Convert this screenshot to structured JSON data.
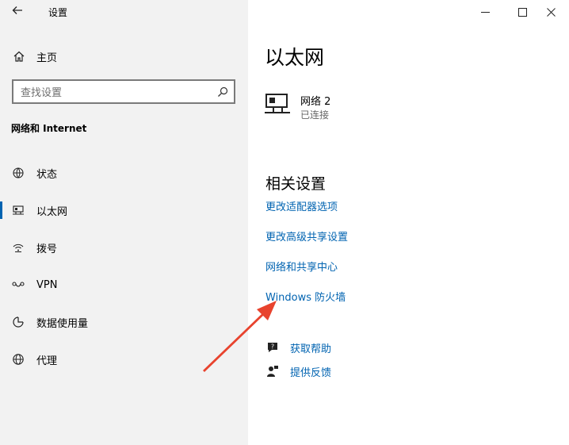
{
  "window": {
    "title": "设置",
    "back_icon": "back-arrow-icon",
    "controls": [
      "minimize-icon",
      "maximize-icon",
      "close-icon"
    ]
  },
  "sidebar": {
    "home_label": "主页",
    "search_placeholder": "查找设置",
    "section_title": "网络和 Internet",
    "items": [
      {
        "label": "状态",
        "icon": "globe-status-icon",
        "active": false
      },
      {
        "label": "以太网",
        "icon": "ethernet-icon",
        "active": true
      },
      {
        "label": "拨号",
        "icon": "dialup-icon",
        "active": false
      },
      {
        "label": "VPN",
        "icon": "vpn-icon",
        "active": false
      },
      {
        "label": "数据使用量",
        "icon": "data-usage-icon",
        "active": false
      },
      {
        "label": "代理",
        "icon": "globe-icon",
        "active": false
      }
    ]
  },
  "main": {
    "title": "以太网",
    "network": {
      "name": "网络 2",
      "status": "已连接",
      "icon": "monitor-network-icon"
    },
    "related_title": "相关设置",
    "links": [
      "更改适配器选项",
      "更改高级共享设置",
      "网络和共享中心",
      "Windows 防火墙"
    ],
    "help": [
      {
        "label": "获取帮助",
        "icon": "help-chat-icon"
      },
      {
        "label": "提供反馈",
        "icon": "feedback-icon"
      }
    ]
  },
  "colors": {
    "accent": "#0063b1",
    "sidebar_bg": "#f2f2f2",
    "annotation": "#e8432e"
  }
}
